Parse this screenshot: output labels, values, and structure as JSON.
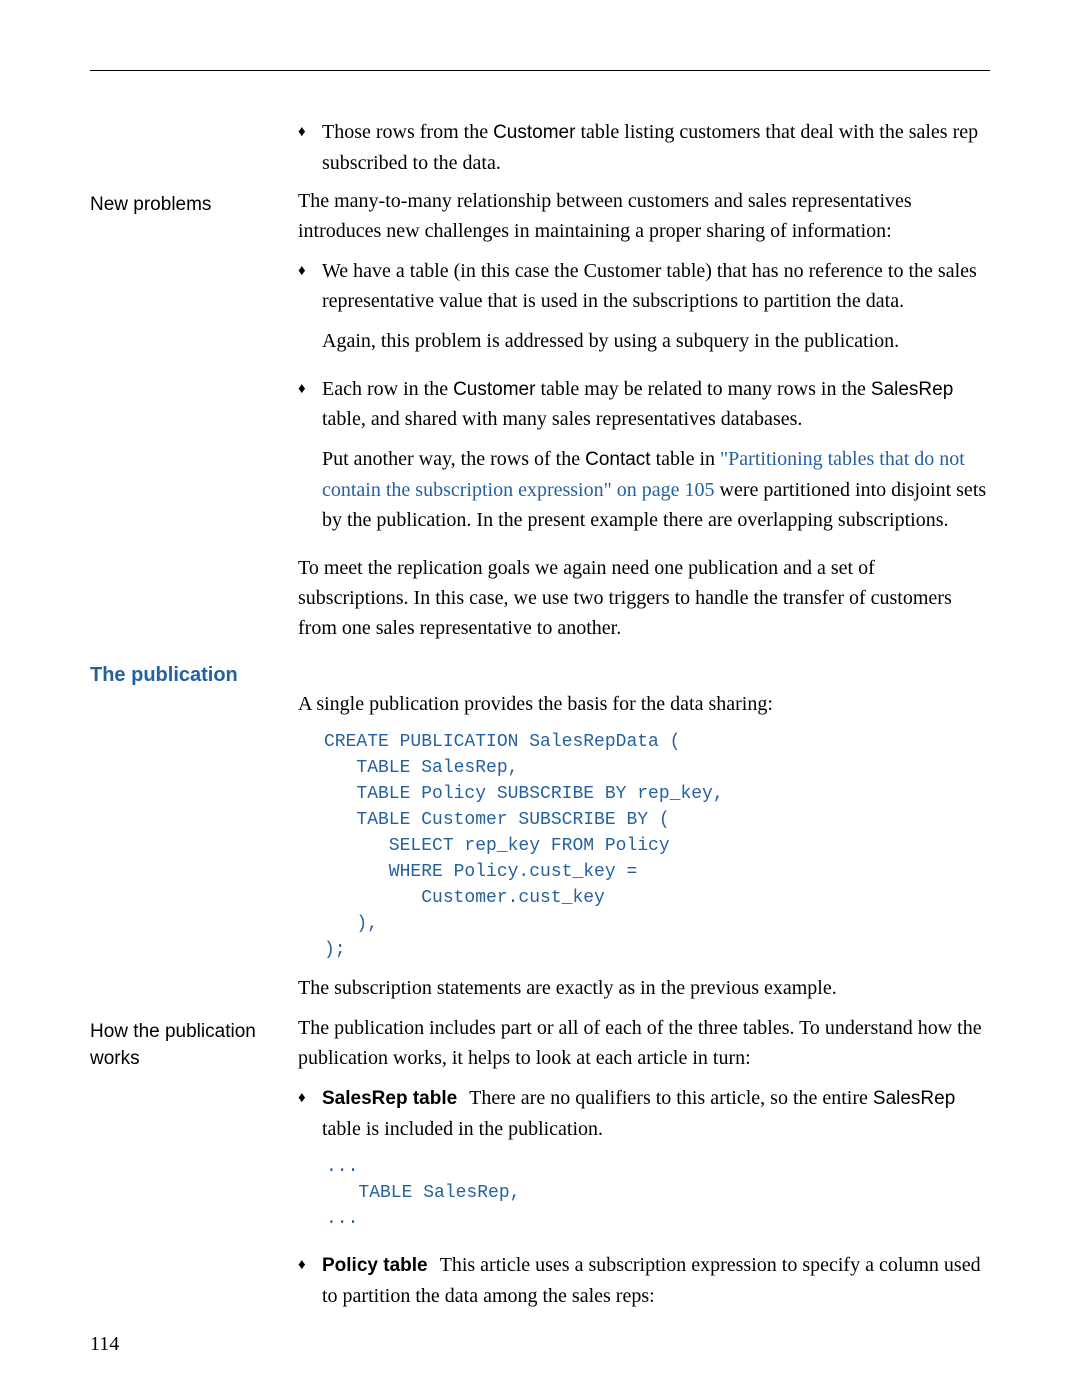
{
  "topRule": true,
  "sidebars": {
    "newProblems": "New problems",
    "thePublication": "The publication",
    "howWorks": "How the publication works"
  },
  "bulletsTop": {
    "b1a": "Those rows from the ",
    "b1code": "Customer",
    "b1b": " table listing customers that deal with the sales rep subscribed to the data."
  },
  "newProblemsIntro": "The many-to-many relationship between customers and sales representatives introduces new challenges in maintaining a proper sharing of information:",
  "np_b1": "We have a table (in this case the Customer table) that has no reference to the sales representative value that is used in the subscriptions to partition the data.",
  "np_b1_follow": "Again, this problem is addressed by using a subquery in the publication.",
  "np_b2a": "Each row in the ",
  "np_b2code1": "Customer",
  "np_b2b": " table may be related to many rows in the ",
  "np_b2code2": "SalesRep",
  "np_b2c": " table, and shared with many sales representatives databases.",
  "np_b2_p2a": "Put another way, the rows of the ",
  "np_b2_p2code": "Contact",
  "np_b2_p2b": " table in ",
  "np_b2_link": "\"Partitioning tables that do not contain the subscription expression\" on page 105",
  "np_b2_p2c": " were partitioned into disjoint sets by the publication. In the present example there are overlapping subscriptions.",
  "np_close": "To meet the replication goals we again need one publication and a set of subscriptions. In this case, we use two triggers to handle the transfer of customers from one sales representative to another.",
  "pub_intro": "A single publication provides the basis for the data sharing:",
  "pub_code": "CREATE PUBLICATION SalesRepData (\n   TABLE SalesRep,\n   TABLE Policy SUBSCRIBE BY rep_key,\n   TABLE Customer SUBSCRIBE BY (\n      SELECT rep_key FROM Policy\n      WHERE Policy.cust_key =\n         Customer.cust_key\n   ),\n);",
  "pub_after": "The subscription statements are exactly as in the previous example.",
  "how_intro": "The publication includes part or all of each of the three tables. To understand how the publication works, it helps to look at each article in turn:",
  "how_b1_run": "SalesRep table",
  "how_b1a": "There are no qualifiers to this article, so the entire ",
  "how_b1code": "SalesRep",
  "how_b1b": " table is included in the publication.",
  "how_b1_code": "...\n   TABLE SalesRep,\n...",
  "how_b2_run": "Policy table",
  "how_b2": "This article uses a subscription expression to specify a column used to partition the data among the sales reps:",
  "pageNum": "114"
}
